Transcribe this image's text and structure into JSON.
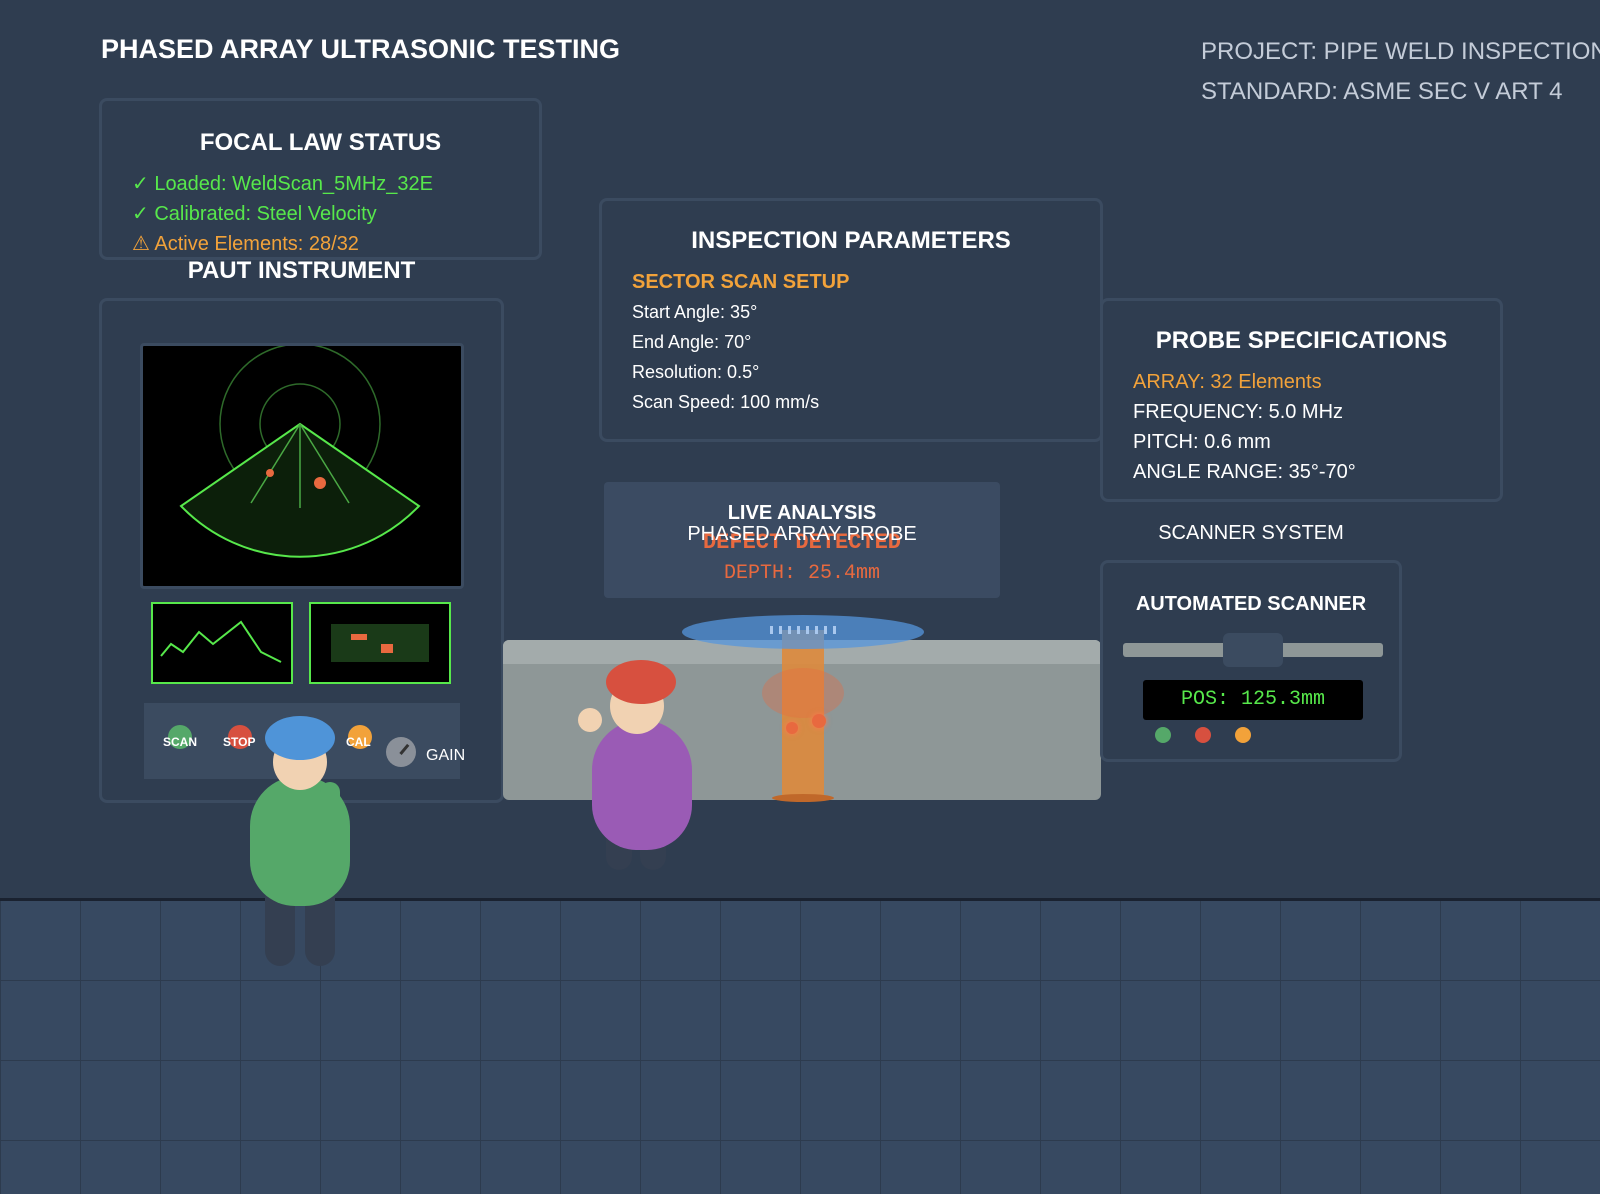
{
  "header": {
    "title": "PHASED ARRAY ULTRASONIC TESTING",
    "project": "PROJECT: PIPE WELD INSPECTION",
    "standard": "STANDARD: ASME SEC V ART 4"
  },
  "focal_law": {
    "title": "FOCAL LAW STATUS",
    "loaded": "✓ Loaded: WeldScan_5MHz_32E",
    "calibrated": "✓ Calibrated: Steel Velocity",
    "active": "⚠ Active Elements: 28/32"
  },
  "instrument": {
    "title": "PAUT INSTRUMENT",
    "buttons": {
      "scan": "SCAN",
      "stop": "STOP",
      "cal": "CAL"
    },
    "gain_label": "GAIN"
  },
  "inspection": {
    "title": "INSPECTION PARAMETERS",
    "subtitle": "SECTOR SCAN SETUP",
    "start_angle": "Start Angle: 35°",
    "end_angle": "End Angle: 70°",
    "resolution": "Resolution: 0.5°",
    "scan_speed": "Scan Speed: 100 mm/s"
  },
  "probe_specs": {
    "title": "PROBE SPECIFICATIONS",
    "array": "ARRAY: 32 Elements",
    "frequency": "FREQUENCY: 5.0 MHz",
    "pitch": "PITCH: 0.6 mm",
    "angle_range": "ANGLE RANGE: 35°-70°"
  },
  "live_analysis": {
    "title": "LIVE ANALYSIS",
    "probe_label": "PHASED ARRAY PROBE",
    "defect": "DEFECT DETECTED",
    "depth": "DEPTH: 25.4mm"
  },
  "scanner": {
    "section_label": "SCANNER SYSTEM",
    "title": "AUTOMATED SCANNER",
    "position": "POS: 125.3mm"
  },
  "colors": {
    "background": "#2f3d50",
    "accent_green": "#57e84b",
    "accent_orange": "#f2a23a",
    "defect": "#e8693f"
  }
}
